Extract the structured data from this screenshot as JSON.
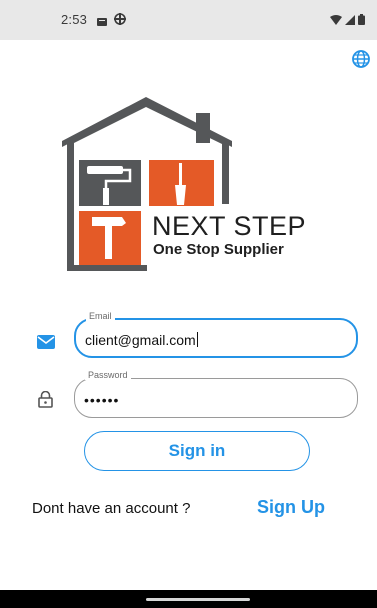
{
  "status_bar": {
    "time": "2:53",
    "icons": [
      "notification-icon",
      "game-controller-icon",
      "wifi-icon",
      "signal-icon",
      "battery-icon"
    ]
  },
  "language_icon": "globe-icon",
  "logo": {
    "line1": "NEXT STEP",
    "line2": "One Stop Supplier"
  },
  "form": {
    "email": {
      "label": "Email",
      "value": "client@gmail.com",
      "icon": "mail-icon"
    },
    "password": {
      "label": "Password",
      "value": "••••••",
      "icon": "lock-icon"
    }
  },
  "signin_label": "Sign in",
  "footer": {
    "question": "Dont have an account ?",
    "signup_label": "Sign Up"
  },
  "colors": {
    "accent": "#2493e6",
    "logo_gray": "#555759",
    "logo_orange": "#e45a27"
  }
}
